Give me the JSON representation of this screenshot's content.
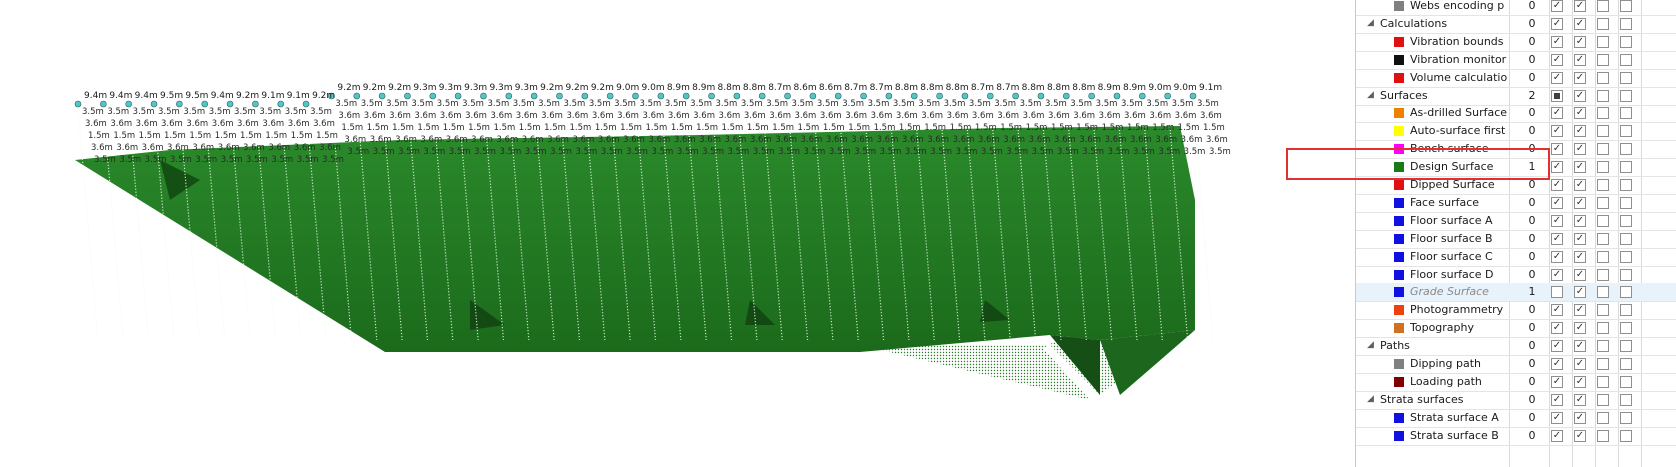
{
  "viewport": {
    "surface_color": "#1f7a1f",
    "label_color": "#1a1a1a",
    "top_labels": [
      "9.4m",
      "9.4m",
      "9.4m",
      "9.5m",
      "9.5m",
      "9.4m",
      "9.2m",
      "9.1m",
      "9.1m",
      "9.2m",
      "9.2m",
      "9.2m",
      "9.2m",
      "9.3m",
      "9.3m",
      "9.3m",
      "9.3m",
      "9.3m",
      "9.2m",
      "9.2m",
      "9.2m",
      "9.0m",
      "9.0m",
      "8.9m",
      "8.9m",
      "8.8m",
      "8.8m",
      "8.7m",
      "8.6m",
      "8.6m",
      "8.7m",
      "8.7m",
      "8.8m",
      "8.8m",
      "8.8m",
      "8.7m",
      "8.7m",
      "8.8m",
      "8.8m",
      "8.8m",
      "8.9m",
      "8.9m",
      "9.0m",
      "9.0m",
      "9.1m"
    ],
    "repeated_label_a": "3.5m",
    "repeated_label_b": "3.6m",
    "repeated_label_c": "1.5m",
    "repeated_label_d": "3.6m",
    "repeated_label_e": "3.5m"
  },
  "layers_panel": {
    "rows": [
      {
        "type": "item",
        "name": "Webs encoding p",
        "color": "#808080",
        "count": "0",
        "c1": "check",
        "c2": "check",
        "c3": "empty",
        "c4": "empty"
      },
      {
        "type": "group",
        "name": "Calculations",
        "count": "0",
        "c1": "check",
        "c2": "check",
        "c3": "empty",
        "c4": "empty"
      },
      {
        "type": "item",
        "name": "Vibration bounds",
        "color": "#e01010",
        "count": "0",
        "c1": "check",
        "c2": "check",
        "c3": "empty",
        "c4": "empty"
      },
      {
        "type": "item",
        "name": "Vibration monitor",
        "color": "#101010",
        "count": "0",
        "c1": "check",
        "c2": "check",
        "c3": "empty",
        "c4": "empty"
      },
      {
        "type": "item",
        "name": "Volume calculatio",
        "color": "#e01010",
        "count": "0",
        "c1": "check",
        "c2": "check",
        "c3": "empty",
        "c4": "empty"
      },
      {
        "type": "group",
        "name": "Surfaces",
        "count": "2",
        "c1": "filled",
        "c2": "check",
        "c3": "empty",
        "c4": "empty"
      },
      {
        "type": "item",
        "name": "As-drilled Surface",
        "color": "#f08000",
        "count": "0",
        "c1": "check",
        "c2": "check",
        "c3": "empty",
        "c4": "empty"
      },
      {
        "type": "item",
        "name": "Auto-surface first",
        "color": "#ffff00",
        "count": "0",
        "c1": "check",
        "c2": "check",
        "c3": "empty",
        "c4": "empty"
      },
      {
        "type": "item",
        "name": "Bench surface",
        "color": "#ff00ff",
        "count": "0",
        "c1": "check",
        "c2": "check",
        "c3": "empty",
        "c4": "empty"
      },
      {
        "type": "item",
        "name": "Design Surface",
        "color": "#1a7a1a",
        "count": "1",
        "c1": "check",
        "c2": "check",
        "c3": "empty",
        "c4": "empty"
      },
      {
        "type": "item",
        "name": "Dipped Surface",
        "color": "#e01010",
        "count": "0",
        "c1": "check",
        "c2": "check",
        "c3": "empty",
        "c4": "empty"
      },
      {
        "type": "item",
        "name": "Face surface",
        "color": "#1010e0",
        "count": "0",
        "c1": "check",
        "c2": "check",
        "c3": "empty",
        "c4": "empty"
      },
      {
        "type": "item",
        "name": "Floor surface A",
        "color": "#1010e0",
        "count": "0",
        "c1": "check",
        "c2": "check",
        "c3": "empty",
        "c4": "empty"
      },
      {
        "type": "item",
        "name": "Floor surface B",
        "color": "#1010e0",
        "count": "0",
        "c1": "check",
        "c2": "check",
        "c3": "empty",
        "c4": "empty"
      },
      {
        "type": "item",
        "name": "Floor surface C",
        "color": "#1010e0",
        "count": "0",
        "c1": "check",
        "c2": "check",
        "c3": "empty",
        "c4": "empty"
      },
      {
        "type": "item",
        "name": "Floor surface D",
        "color": "#1010e0",
        "count": "0",
        "c1": "check",
        "c2": "check",
        "c3": "empty",
        "c4": "empty"
      },
      {
        "type": "item",
        "name": "Grade Surface",
        "color": "#1010e0",
        "count": "1",
        "c1": "empty",
        "c2": "check",
        "c3": "empty",
        "c4": "empty",
        "italic": true
      },
      {
        "type": "item",
        "name": "Photogrammetry",
        "color": "#f04010",
        "count": "0",
        "c1": "check",
        "c2": "check",
        "c3": "empty",
        "c4": "empty"
      },
      {
        "type": "item",
        "name": "Topography",
        "color": "#d07020",
        "count": "0",
        "c1": "check",
        "c2": "check",
        "c3": "empty",
        "c4": "empty"
      },
      {
        "type": "group",
        "name": "Paths",
        "count": "0",
        "c1": "check",
        "c2": "check",
        "c3": "empty",
        "c4": "empty"
      },
      {
        "type": "item",
        "name": "Dipping path",
        "color": "#808080",
        "count": "0",
        "c1": "check",
        "c2": "check",
        "c3": "empty",
        "c4": "empty"
      },
      {
        "type": "item",
        "name": "Loading path",
        "color": "#800000",
        "count": "0",
        "c1": "check",
        "c2": "check",
        "c3": "empty",
        "c4": "empty"
      },
      {
        "type": "group",
        "name": "Strata surfaces",
        "count": "0",
        "c1": "check",
        "c2": "check",
        "c3": "empty",
        "c4": "empty"
      },
      {
        "type": "item",
        "name": "Strata surface A",
        "color": "#1010e0",
        "count": "0",
        "c1": "check",
        "c2": "check",
        "c3": "empty",
        "c4": "empty"
      },
      {
        "type": "item",
        "name": "Strata surface B",
        "color": "#1010e0",
        "count": "0",
        "c1": "check",
        "c2": "check",
        "c3": "empty",
        "c4": "empty"
      }
    ],
    "check_glyph": "✓",
    "group_toggle_glyph": "◢"
  }
}
